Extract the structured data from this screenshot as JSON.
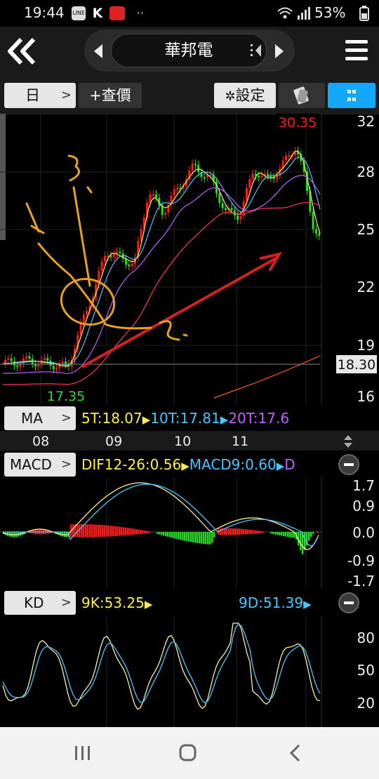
{
  "status": {
    "time": "19:44",
    "battery": "53%"
  },
  "header": {
    "title": "華邦電"
  },
  "toolbar": {
    "period": "日",
    "quote": "+查價",
    "settings": "設定"
  },
  "price_chart": {
    "high_label": "30.35",
    "low_label": "17.35",
    "current_price": "18.30",
    "y_ticks": [
      "32",
      "28",
      "25",
      "22",
      "19",
      "16"
    ],
    "x_ticks": [
      "08",
      "09",
      "10",
      "11"
    ]
  },
  "ma": {
    "button": "MA",
    "t5": "5T:18.07",
    "t10": "10T:17.81",
    "t20": "20T:17.6"
  },
  "macd": {
    "button": "MACD",
    "dif": "DIF12-26:0.56",
    "macd9": "MACD9:0.60",
    "d": "D",
    "y_ticks": [
      "1.7",
      "0.9",
      "0.0",
      "-0.9",
      "-1.7"
    ]
  },
  "kd": {
    "button": "KD",
    "k": "9K:53.25",
    "d": "9D:51.39",
    "y_ticks": [
      "80",
      "50",
      "20"
    ]
  },
  "colors": {
    "up": "#ff1a1a",
    "down": "#22dd22",
    "accent": "#12a8ff",
    "ma5": "#ffee44",
    "ma10": "#44c8ff",
    "ma20": "#c060ff",
    "ma60": "#ff3366",
    "annotation_orange": "#e8a020",
    "annotation_red": "#d42020"
  },
  "chart_data": [
    {
      "type": "candlestick",
      "title": "",
      "y_ticks": [
        32,
        28,
        25,
        22,
        19,
        16
      ],
      "ylim": [
        16,
        32
      ],
      "x_ticks": [
        "08",
        "09",
        "10",
        "11"
      ],
      "annotations": [
        "30.35",
        "17.35",
        "18.30"
      ],
      "series_legend": [
        "5T:18.07",
        "10T:17.81",
        "20T:17.6"
      ]
    },
    {
      "type": "line",
      "title": "",
      "series_legend": [
        "DIF12-26:0.56",
        "MACD9:0.60"
      ],
      "y_ticks": [
        1.7,
        0.9,
        0.0,
        -0.9,
        -1.7
      ],
      "ylim": [
        -1.7,
        1.7
      ]
    },
    {
      "type": "line",
      "title": "",
      "series_legend": [
        "9K:53.25",
        "9D:51.39"
      ],
      "y_ticks": [
        80,
        50,
        20
      ],
      "ylim": [
        0,
        100
      ]
    }
  ]
}
